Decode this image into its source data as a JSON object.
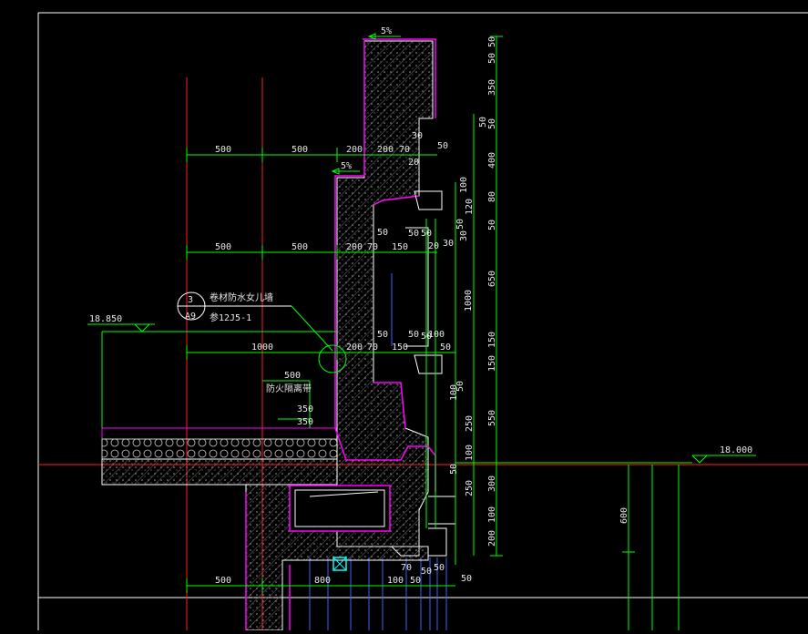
{
  "drawing": {
    "colors": {
      "background": "#000000",
      "dimension": "#00ff00",
      "outline": "#ff00ff",
      "axis": "#ff2020",
      "frame": "#ffffff",
      "hatch": "#707070",
      "grid": "#4060ff",
      "marker": "#00ffff"
    },
    "elevations": {
      "left": "18.850",
      "right": "18.000"
    },
    "slope_labels": [
      "5%",
      "5%"
    ],
    "callout": {
      "number": "3",
      "sheet": "A9",
      "title": "卷材防水女儿墙",
      "reference": "参12J5-1"
    },
    "note": "防火隔离带",
    "dims_h_row1": [
      "500",
      "500",
      "200",
      "200",
      "70",
      "30",
      "50",
      "20"
    ],
    "dims_h_row2": [
      "500",
      "500",
      "200",
      "70",
      "150",
      "50",
      "50",
      "20",
      "30",
      "50"
    ],
    "dims_h_row3": [
      "1000",
      "200",
      "70",
      "150",
      "50",
      "50",
      "100",
      "50",
      "50"
    ],
    "dims_h_row4": [
      "500",
      "350",
      "350"
    ],
    "dims_h_row5": [
      "500",
      "800",
      "100",
      "70",
      "50",
      "50",
      "50",
      "50"
    ],
    "dims_v_outer": [
      "50",
      "50",
      "350",
      "50",
      "400",
      "80",
      "50",
      "650",
      "150",
      "150",
      "550",
      "300",
      "100",
      "200"
    ],
    "dims_v_inner": [
      "50",
      "100",
      "120",
      "50",
      "30",
      "1000",
      "50",
      "100",
      "250",
      "100",
      "50",
      "250"
    ],
    "dim_600": "600"
  }
}
